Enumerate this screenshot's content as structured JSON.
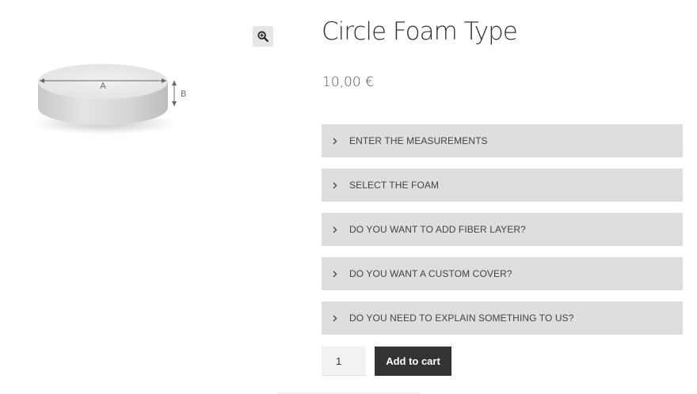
{
  "product": {
    "title": "Circle Foam Type",
    "price": "10,00 €",
    "image": {
      "label_a": "A",
      "label_b": "B"
    }
  },
  "zoom": {
    "icon": "zoom-in-icon"
  },
  "accordion": {
    "items": [
      {
        "label": "ENTER THE MEASUREMENTS"
      },
      {
        "label": "SELECT THE FOAM"
      },
      {
        "label": "DO YOU WANT TO ADD FIBER LAYER?"
      },
      {
        "label": "DO YOU WANT A CUSTOM COVER?"
      },
      {
        "label": "DO YOU NEED TO EXPLAIN SOMETHING TO US?"
      }
    ]
  },
  "cart": {
    "quantity": "1",
    "add_label": "Add to cart"
  },
  "colors": {
    "accordion_bg": "#dedede",
    "button_bg": "#333333",
    "button_text": "#ffffff"
  }
}
